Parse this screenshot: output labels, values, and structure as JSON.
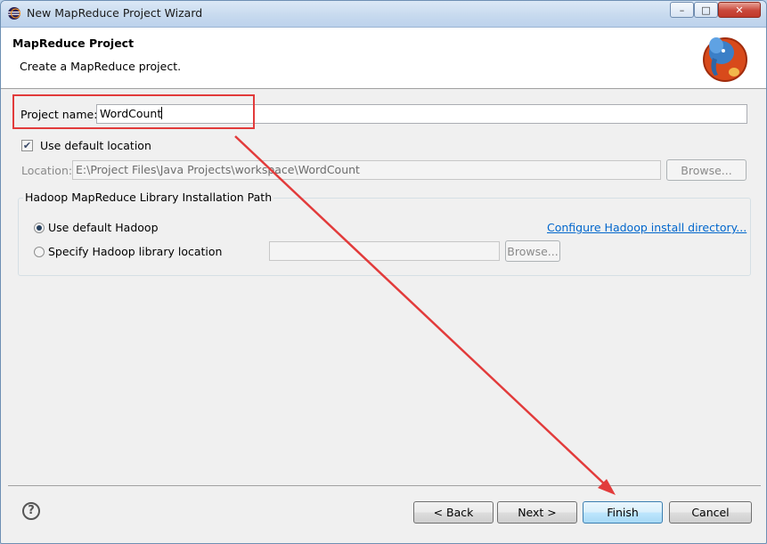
{
  "window": {
    "title": "New MapReduce Project Wizard",
    "controls": {
      "minimize": "–",
      "maximize": "□",
      "close": "✕"
    }
  },
  "header": {
    "title": "MapReduce Project",
    "description": "Create a MapReduce project.",
    "logo_icon": "hadoop-elephant-icon"
  },
  "form": {
    "project_name_label": "Project name:",
    "project_name_value": "WordCount",
    "use_default_location_label": "Use default location",
    "use_default_location_checked": true,
    "location_label": "Location:",
    "location_value": "E:\\Project Files\\Java Projects\\workspace\\WordCount",
    "browse_label": "Browse..."
  },
  "hadoop_group": {
    "title": "Hadoop MapReduce Library Installation Path",
    "use_default_hadoop_label": "Use default Hadoop",
    "specify_label": "Specify Hadoop library location",
    "configure_link": "Configure Hadoop install directory...",
    "browse_label": "Browse...",
    "selected_option": "Use default Hadoop"
  },
  "footer": {
    "back_label": "< Back",
    "next_label": "Next >",
    "finish_label": "Finish",
    "cancel_label": "Cancel"
  },
  "annotation": {
    "color": "#e23b3b"
  }
}
